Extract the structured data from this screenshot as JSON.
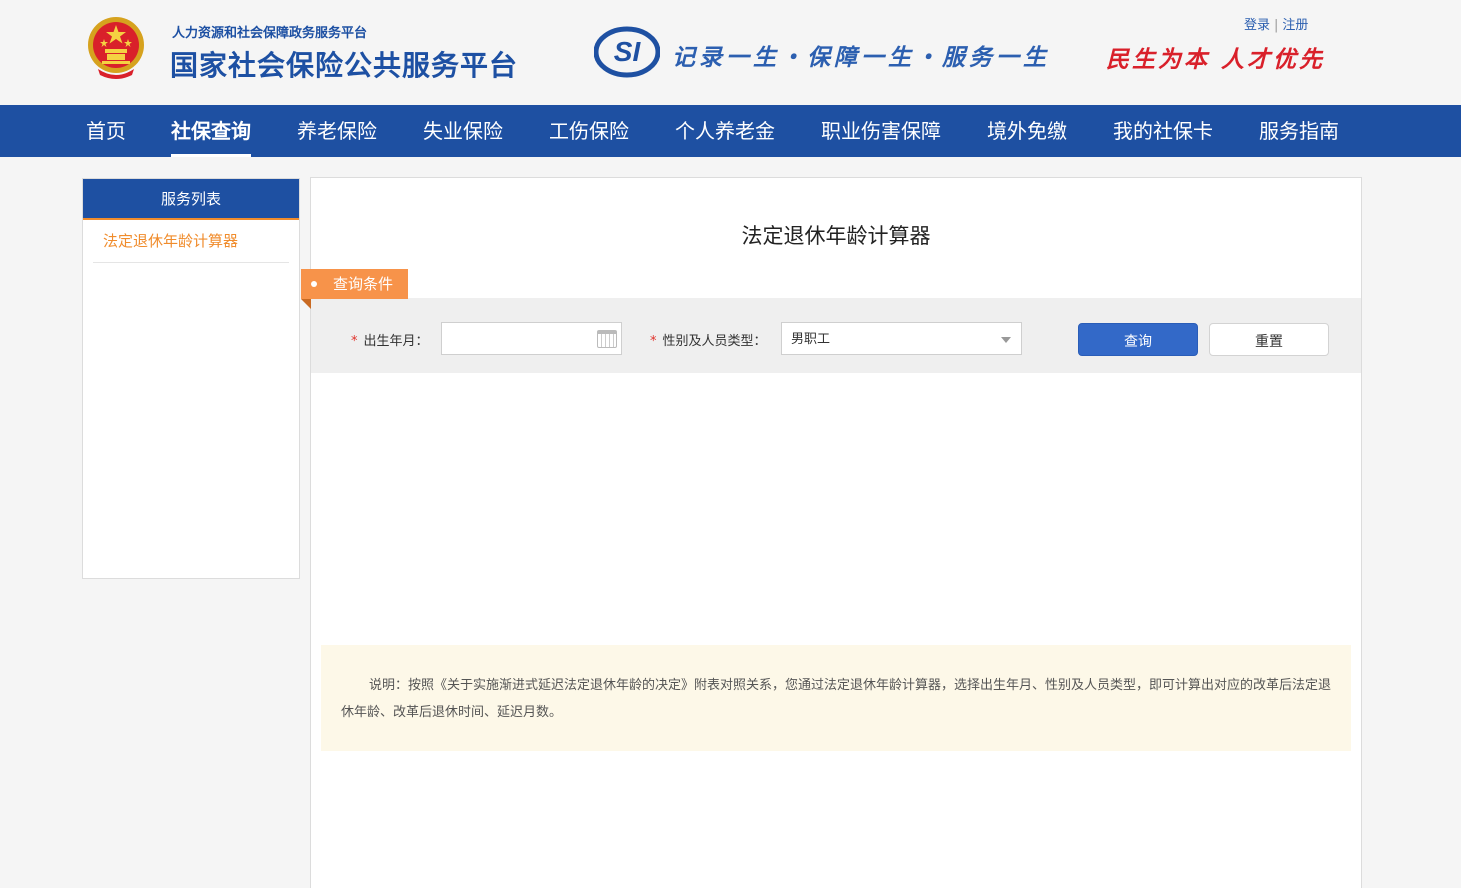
{
  "header": {
    "sub_title": "人力资源和社会保障政务服务平台",
    "main_title": "国家社会保险公共服务平台",
    "si_logo_text": "SI",
    "slogan": "记录一生・保障一生・服务一生",
    "red_slogan": "民生为本 人才优先",
    "login": "登录",
    "register": "注册",
    "separator": "|"
  },
  "nav": {
    "items": [
      {
        "label": "首页"
      },
      {
        "label": "社保查询"
      },
      {
        "label": "养老保险"
      },
      {
        "label": "失业保险"
      },
      {
        "label": "工伤保险"
      },
      {
        "label": "个人养老金"
      },
      {
        "label": "职业伤害保障"
      },
      {
        "label": "境外免缴"
      },
      {
        "label": "我的社保卡"
      },
      {
        "label": "服务指南"
      }
    ],
    "active": "社保查询"
  },
  "sidebar": {
    "title": "服务列表",
    "items": [
      {
        "label": "法定退休年龄计算器"
      }
    ]
  },
  "main": {
    "title": "法定退休年龄计算器",
    "section_tag": "查询条件",
    "form": {
      "birth_label": "出生年月：",
      "birth_value": "",
      "type_label": "性别及人员类型：",
      "type_value": "男职工",
      "required_mark": "*",
      "query_button": "查询",
      "reset_button": "重置"
    },
    "note": "说明：按照《关于实施渐进式延迟法定退休年龄的决定》附表对照关系，您通过法定退休年龄计算器，选择出生年月、性别及人员类型，即可计算出对应的改革后法定退休年龄、改革后退休时间、延迟月数。"
  },
  "colors": {
    "brand_blue": "#1e50a2",
    "accent_orange": "#f7934a",
    "button_blue": "#3369c8",
    "slogan_red": "#d9202a"
  },
  "icons": {
    "emblem": "national-emblem-icon",
    "calendar": "calendar-icon",
    "dropdown": "chevron-down-icon"
  }
}
